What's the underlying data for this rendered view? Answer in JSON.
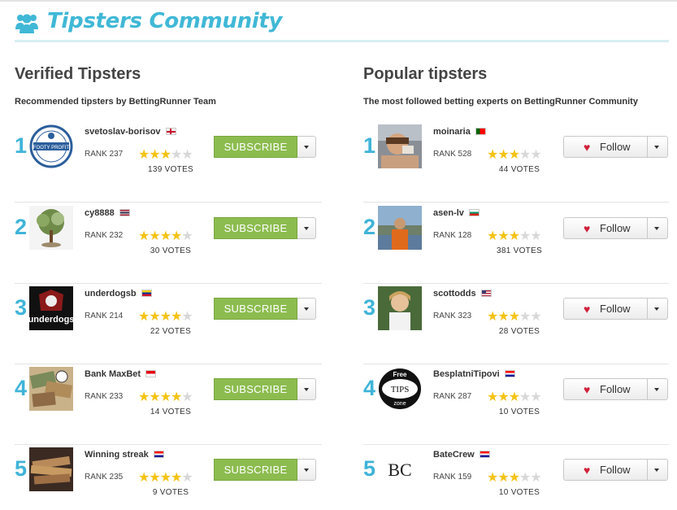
{
  "header": {
    "title": "Tipsters Community",
    "icon": "users-icon",
    "accent": "#40b8d6"
  },
  "verified": {
    "heading": "Verified Tipsters",
    "subheading": "Recommended tipsters by BettingRunner Team",
    "button_label": "SUBSCRIBE",
    "items": [
      {
        "position": "1",
        "name": "svetoslav-borisov",
        "flag": "GB",
        "rank": "RANK 237",
        "stars": 3,
        "votes": "139 VOTES"
      },
      {
        "position": "2",
        "name": "cy8888",
        "flag": "TH",
        "rank": "RANK 232",
        "stars": 4,
        "votes": "30 VOTES"
      },
      {
        "position": "3",
        "name": "underdogsb",
        "flag": "VE",
        "rank": "RANK 214",
        "stars": 4,
        "votes": "22 VOTES"
      },
      {
        "position": "4",
        "name": "Bank MaxBet",
        "flag": "ID",
        "rank": "RANK 233",
        "stars": 4,
        "votes": "14 VOTES"
      },
      {
        "position": "5",
        "name": "Winning streak",
        "flag": "HR",
        "rank": "RANK 235",
        "stars": 4,
        "votes": "9 VOTES"
      }
    ]
  },
  "popular": {
    "heading": "Popular tipsters",
    "subheading": "The most followed betting experts on BettingRunner Community",
    "button_label": "Follow",
    "items": [
      {
        "position": "1",
        "name": "moinaria",
        "flag": "PT",
        "rank": "RANK 528",
        "stars": 3,
        "votes": "44 VOTES"
      },
      {
        "position": "2",
        "name": "asen-lv",
        "flag": "BG",
        "rank": "RANK 128",
        "stars": 3,
        "votes": "381 VOTES"
      },
      {
        "position": "3",
        "name": "scottodds",
        "flag": "US",
        "rank": "RANK 323",
        "stars": 3,
        "votes": "28 VOTES"
      },
      {
        "position": "4",
        "name": "BesplatniTipovi",
        "flag": "HR",
        "rank": "RANK 287",
        "stars": 3,
        "votes": "10 VOTES"
      },
      {
        "position": "5",
        "name": "BateCrew",
        "flag": "HR",
        "rank": "RANK 159",
        "stars": 3,
        "votes": "10 VOTES"
      }
    ]
  },
  "avatars": {
    "footy_profit": "FOOTY PROFIT",
    "underdogs": "underdogs",
    "free_tips_top": "Free",
    "free_tips_mid": "TIPS",
    "free_tips_bottom": "zone",
    "batecrew": "BC"
  },
  "colors": {
    "subscribe": "#8cbc4f",
    "rank_number": "#3fb4d8",
    "star_on": "#f4c315",
    "star_off": "#d8d8d8",
    "heart": "#d0213b"
  }
}
